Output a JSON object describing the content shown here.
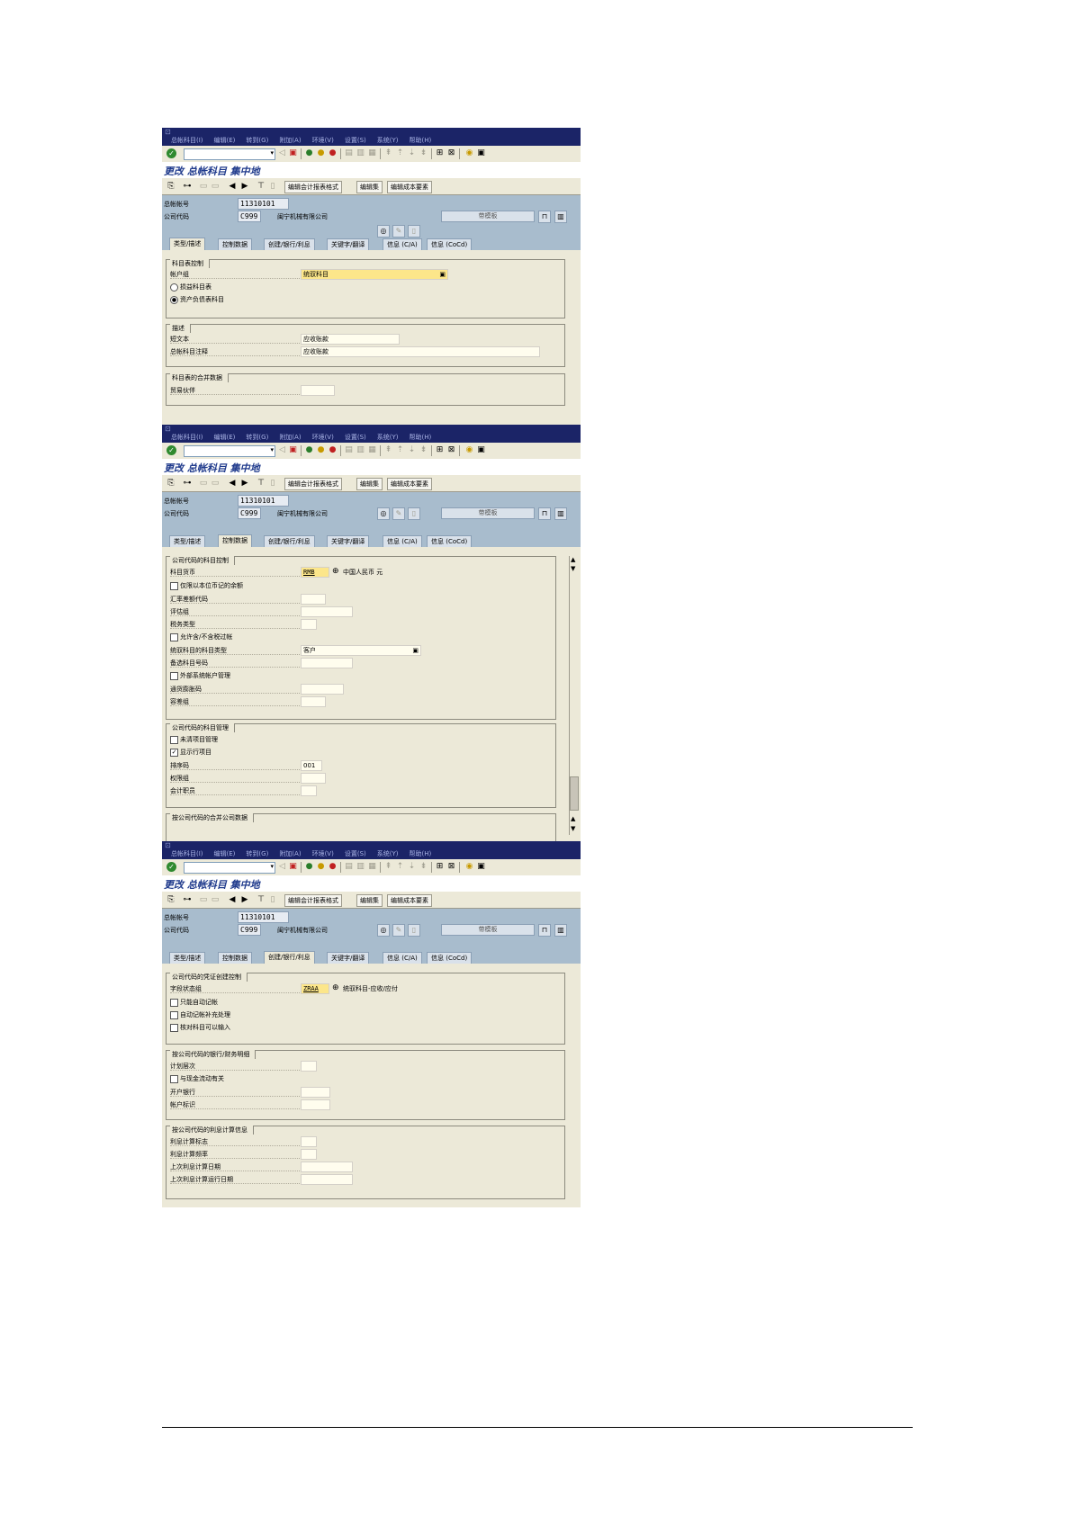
{
  "common": {
    "menu": [
      "总帐科目(I)",
      "编辑(E)",
      "转到(G)",
      "附加(A)",
      "环境(V)",
      "设置(S)",
      "系统(Y)",
      "帮助(H)"
    ],
    "title": "更改 总帐科目 集中地",
    "app_buttons": [
      "编辑会计报表格式",
      "编辑集",
      "编辑成本要素"
    ],
    "header": {
      "account_label": "总帐帐号",
      "account_value": "11310101",
      "company_label": "公司代码",
      "company_value": "C999",
      "company_name": "闽宁机械有限公司",
      "template_label": "带模板"
    },
    "tabs": [
      "类型/描述",
      "控制数据",
      "创建/银行/利息",
      "关键字/翻译",
      "信息 (C/A)",
      "信息 (CoCd)"
    ]
  },
  "screen1": {
    "group1": {
      "title": "科目表控制",
      "account_group_label": "帐户组",
      "account_group_value": "统驭科目",
      "radio1": "损益科目表",
      "radio2": "资产负债表科目"
    },
    "group2": {
      "title": "描述",
      "short_label": "短文本",
      "short_value": "应收账款",
      "long_label": "总帐科目注释",
      "long_value": "应收账款"
    },
    "group3": {
      "title": "科目表的合并数据",
      "partner_label": "贸易伙伴"
    }
  },
  "screen2": {
    "group1": {
      "title": "公司代码的科目控制",
      "currency_label": "科目货币",
      "currency_value": "RMB",
      "currency_text": "中国人民币 元",
      "only_local_label": "仅限以本位币记的余额",
      "exchange_label": "汇率差额代码",
      "valuation_label": "评估组",
      "tax_label": "税务类型",
      "no_tax_label": "允许含/不含税过帐",
      "recon_label": "统驭科目的科目类型",
      "recon_value": "客户",
      "alt_label": "备选科目号码",
      "ext_label": "外部系统帐户管理",
      "inflation_label": "通货膨胀码",
      "tolerance_label": "容差组"
    },
    "group2": {
      "title": "公司代码的科目管理",
      "open_item_label": "未清项目管理",
      "line_item_label": "显示行项目",
      "sort_label": "排序码",
      "sort_value": "001",
      "auth_label": "权限组",
      "clerk_label": "会计职员"
    },
    "group3": {
      "title": "按公司代码的合并公司数据"
    }
  },
  "screen3": {
    "group1": {
      "title": "公司代码的凭证创建控制",
      "field_status_label": "字段状态组",
      "field_status_value": "ZRAA",
      "field_status_text": "统驭科目-应收/应付",
      "auto_post_label": "只能自动记帐",
      "supplement_label": "自动记帐补充处理",
      "recon_input_label": "核对科目可以输入"
    },
    "group2": {
      "title": "按公司代码的银行/财务明细",
      "planning_label": "计划层次",
      "cashflow_label": "与现金流动有关",
      "bank_label": "开户银行",
      "acct_id_label": "帐户标识"
    },
    "group3": {
      "title": "按公司代码的利息计算信息",
      "ind_label": "利息计算标志",
      "freq_label": "利息计算频率",
      "last_key_label": "上次利息计算日期",
      "last_run_label": "上次利息计算运行日期"
    }
  }
}
